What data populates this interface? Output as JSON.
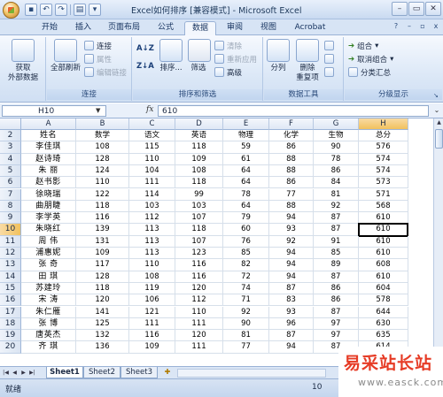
{
  "window": {
    "title": "Excel如何排序  [兼容模式] - Microsoft Excel",
    "controls": [
      "–",
      "▭",
      "✕"
    ]
  },
  "tabs": [
    "开始",
    "插入",
    "页面布局",
    "公式",
    "数据",
    "审阅",
    "视图",
    "Acrobat"
  ],
  "active_tab": "数据",
  "ribbon": {
    "get_data": {
      "line1": "获取",
      "line2": "外部数据"
    },
    "connections": {
      "refresh_all": "全部刷新",
      "connections": "连接",
      "properties": "属性",
      "edit_links": "编辑链接",
      "group": "连接"
    },
    "sort_filter": {
      "sort": "排序...",
      "filter": "筛选",
      "clear": "清除",
      "reapply": "重新应用",
      "advanced": "高级",
      "group": "排序和筛选"
    },
    "data_tools": {
      "text_to_columns": "分列",
      "remove_duplicates_1": "删除",
      "remove_duplicates_2": "重复项",
      "group": "数据工具"
    },
    "outline": {
      "group_btn": "组合",
      "ungroup_btn": "取消组合",
      "subtotal": "分类汇总",
      "group": "分级显示"
    }
  },
  "formula_bar": {
    "name_box": "H10",
    "fx": "fx",
    "value": "610"
  },
  "grid": {
    "columns": [
      "A",
      "B",
      "C",
      "D",
      "E",
      "F",
      "G",
      "H"
    ],
    "active_column": "H",
    "active_row": "10",
    "rows": [
      {
        "n": "2",
        "cells": [
          "姓名",
          "数学",
          "语文",
          "英语",
          "物理",
          "化学",
          "生物",
          "总分"
        ]
      },
      {
        "n": "3",
        "cells": [
          "李佳琪",
          "108",
          "115",
          "118",
          "59",
          "86",
          "90",
          "576"
        ]
      },
      {
        "n": "4",
        "cells": [
          "赵诗琦",
          "128",
          "110",
          "109",
          "61",
          "88",
          "78",
          "574"
        ]
      },
      {
        "n": "5",
        "cells": [
          "朱  丽",
          "124",
          "104",
          "108",
          "64",
          "88",
          "86",
          "574"
        ]
      },
      {
        "n": "6",
        "cells": [
          "赵书影",
          "110",
          "111",
          "118",
          "64",
          "86",
          "84",
          "573"
        ]
      },
      {
        "n": "7",
        "cells": [
          "徐晓瑞",
          "122",
          "114",
          "99",
          "78",
          "77",
          "81",
          "571"
        ]
      },
      {
        "n": "8",
        "cells": [
          "曲朋睫",
          "118",
          "103",
          "103",
          "64",
          "88",
          "92",
          "568"
        ]
      },
      {
        "n": "9",
        "cells": [
          "李学英",
          "116",
          "112",
          "107",
          "79",
          "94",
          "87",
          "610"
        ]
      },
      {
        "n": "10",
        "cells": [
          "朱晓红",
          "139",
          "113",
          "118",
          "60",
          "93",
          "87",
          "610"
        ]
      },
      {
        "n": "11",
        "cells": [
          "周  伟",
          "131",
          "113",
          "107",
          "76",
          "92",
          "91",
          "610"
        ]
      },
      {
        "n": "12",
        "cells": [
          "浦惠妮",
          "109",
          "113",
          "123",
          "85",
          "94",
          "85",
          "610"
        ]
      },
      {
        "n": "13",
        "cells": [
          "张  奇",
          "117",
          "110",
          "116",
          "82",
          "94",
          "89",
          "608"
        ]
      },
      {
        "n": "14",
        "cells": [
          "田  琪",
          "128",
          "108",
          "116",
          "72",
          "94",
          "87",
          "610"
        ]
      },
      {
        "n": "15",
        "cells": [
          "苏建玲",
          "118",
          "119",
          "120",
          "74",
          "87",
          "86",
          "604"
        ]
      },
      {
        "n": "16",
        "cells": [
          "宋  涛",
          "120",
          "106",
          "112",
          "71",
          "83",
          "86",
          "578"
        ]
      },
      {
        "n": "17",
        "cells": [
          "朱仁雁",
          "141",
          "121",
          "110",
          "92",
          "93",
          "87",
          "644"
        ]
      },
      {
        "n": "18",
        "cells": [
          "张  博",
          "125",
          "111",
          "111",
          "90",
          "96",
          "97",
          "630"
        ]
      },
      {
        "n": "19",
        "cells": [
          "唐英杰",
          "132",
          "116",
          "120",
          "81",
          "87",
          "97",
          "635"
        ]
      },
      {
        "n": "20",
        "cells": [
          "齐  琪",
          "136",
          "109",
          "111",
          "77",
          "94",
          "87",
          "614"
        ]
      }
    ]
  },
  "sheets": [
    "Sheet1",
    "Sheet2",
    "Sheet3"
  ],
  "active_sheet": "Sheet1",
  "status": {
    "mode": "就绪",
    "zoom": "10"
  },
  "watermark": {
    "text": "易采站长站",
    "url": "www.easck.com"
  },
  "colors": {
    "accent": "#f1c15d",
    "ribbon": "#dce8f7",
    "watermark": "#e63b25"
  }
}
